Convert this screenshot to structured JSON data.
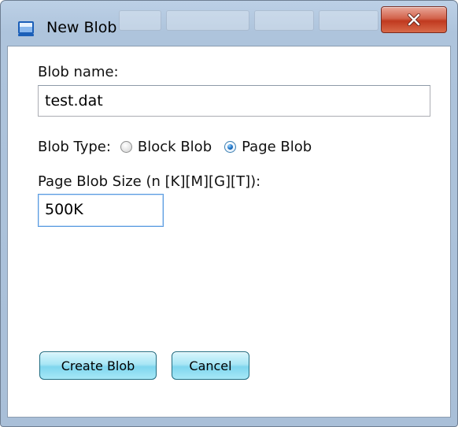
{
  "window": {
    "title": "New Blob",
    "icon": "window-icon",
    "close_icon": "close-x-icon"
  },
  "form": {
    "blob_name_label": "Blob name:",
    "blob_name_value": "test.dat",
    "blob_type_label": "Blob Type:",
    "blob_type_options": [
      {
        "label": "Block Blob",
        "selected": false
      },
      {
        "label": "Page Blob",
        "selected": true
      }
    ],
    "page_size_label": "Page Blob Size (n [K][M][G][T]):",
    "page_size_value": "500K"
  },
  "buttons": {
    "create_label": "Create Blob",
    "cancel_label": "Cancel"
  },
  "colors": {
    "titlebar": "#aec4dc",
    "close_button": "#c0391f",
    "action_button": "#7fd6ee"
  }
}
